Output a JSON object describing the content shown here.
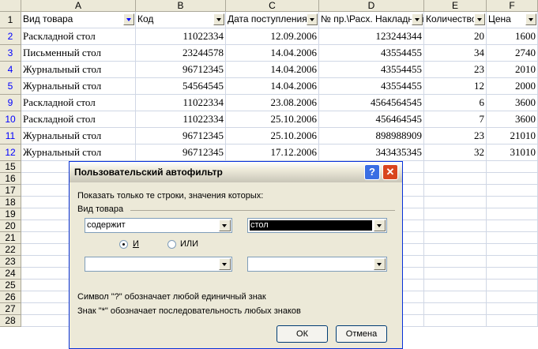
{
  "columns": [
    "A",
    "B",
    "C",
    "D",
    "E",
    "F"
  ],
  "header_row": {
    "number": "1",
    "cells": [
      "Вид товара",
      "Код",
      "Дата поступления",
      "№ пр.\\Расх. Накладной",
      "Количество",
      "Цена"
    ]
  },
  "rows": [
    {
      "num": "2",
      "cells": [
        "Раскладной стол",
        "11022334",
        "12.09.2006",
        "123244344",
        "20",
        "1600"
      ]
    },
    {
      "num": "3",
      "cells": [
        "Письменный стол",
        "23244578",
        "14.04.2006",
        "43554455",
        "34",
        "2740"
      ]
    },
    {
      "num": "4",
      "cells": [
        "Журнальный стол",
        "96712345",
        "14.04.2006",
        "43554455",
        "23",
        "2010"
      ]
    },
    {
      "num": "5",
      "cells": [
        "Журнальный стол",
        "54564545",
        "14.04.2006",
        "43554455",
        "12",
        "2000"
      ]
    },
    {
      "num": "9",
      "cells": [
        "Раскладной стол",
        "11022334",
        "23.08.2006",
        "4564564545",
        "6",
        "3600"
      ]
    },
    {
      "num": "10",
      "cells": [
        "Раскладной стол",
        "11022334",
        "25.10.2006",
        "456464545",
        "7",
        "3600"
      ]
    },
    {
      "num": "11",
      "cells": [
        "Журнальный стол",
        "96712345",
        "25.10.2006",
        "898988909",
        "23",
        "21010"
      ]
    },
    {
      "num": "12",
      "cells": [
        "Журнальный стол",
        "96712345",
        "17.12.2006",
        "343435345",
        "32",
        "31010"
      ]
    }
  ],
  "empty_rows": [
    "15",
    "16",
    "17",
    "18",
    "19",
    "20",
    "21",
    "22",
    "23",
    "24",
    "25",
    "26",
    "27",
    "28"
  ],
  "dialog": {
    "title": "Пользовательский автофильтр",
    "help_glyph": "?",
    "close_glyph": "✕",
    "instruction": "Показать только те строки, значения которых:",
    "field_label": "Вид товара",
    "condition1_operator": "содержит",
    "condition1_value": "стол",
    "radio_and": "И",
    "radio_or": "ИЛИ",
    "condition2_operator": "",
    "condition2_value": "",
    "hint1": "Символ \"?\" обозначает любой единичный знак",
    "hint2": "Знак \"*\" обозначает последовательность любых знаков",
    "ok_label": "ОК",
    "cancel_label": "Отмена"
  }
}
